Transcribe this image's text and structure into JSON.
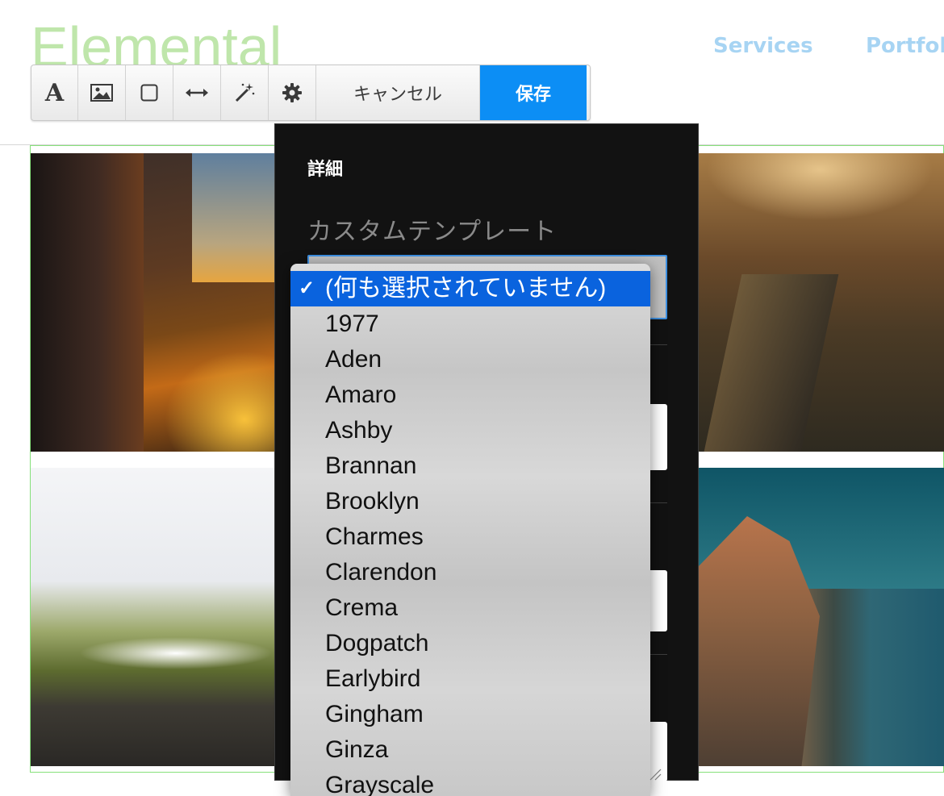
{
  "site": {
    "logo": "Elemental",
    "nav": [
      "Services",
      "Portfoli"
    ]
  },
  "toolbar": {
    "buttons": [
      {
        "name": "font",
        "icon": "font-icon",
        "glyph": "A"
      },
      {
        "name": "image",
        "icon": "image-icon"
      },
      {
        "name": "shape",
        "icon": "square-icon"
      },
      {
        "name": "width",
        "icon": "arrows-horizontal-icon"
      },
      {
        "name": "magic",
        "icon": "magic-wand-icon"
      },
      {
        "name": "settings",
        "icon": "gear-icon"
      }
    ],
    "cancel_label": "キャンセル",
    "save_label": "保存",
    "save_color": "#0c8ef5"
  },
  "panel": {
    "title": "詳細",
    "custom_template_label": "カスタムテンプレート"
  },
  "dropdown": {
    "check": "✓",
    "selected_index": 0,
    "options": [
      "(何も選択されていません)",
      "1977",
      "Aden",
      "Amaro",
      "Ashby",
      "Brannan",
      "Brooklyn",
      "Charmes",
      "Clarendon",
      "Crema",
      "Dogpatch",
      "Earlybird",
      "Gingham",
      "Ginza",
      "Grayscale"
    ]
  }
}
